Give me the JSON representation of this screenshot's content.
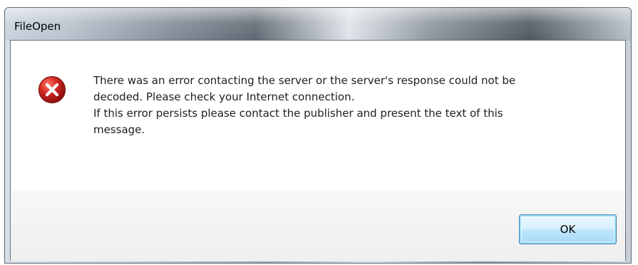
{
  "window": {
    "title": "FileOpen"
  },
  "message": {
    "lines": [
      "There was an error contacting the server or the server's response could not be",
      "decoded. Please check your Internet connection.",
      "If this error persists please contact the publisher and present the text of this",
      "message."
    ]
  },
  "buttons": {
    "ok_label": "OK"
  },
  "icons": {
    "status": "error-icon"
  },
  "colors": {
    "error_red": "#c91f1f",
    "button_border": "#3c7fb1"
  }
}
